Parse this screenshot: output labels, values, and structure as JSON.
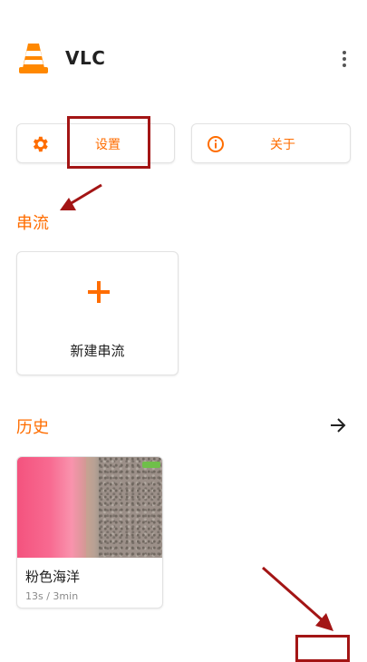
{
  "app": {
    "title": "VLC",
    "logo_icon": "vlc-cone-icon",
    "menu_icon": "more-vertical-icon"
  },
  "actions": {
    "settings": {
      "label": "设置",
      "icon": "gear-icon"
    },
    "about": {
      "label": "关于",
      "icon": "info-icon"
    }
  },
  "stream": {
    "section_title": "串流",
    "new_stream_label": "新建串流",
    "plus_icon": "plus-icon"
  },
  "history": {
    "section_title": "历史",
    "arrow_icon": "arrow-right-icon",
    "items": [
      {
        "title": "粉色海洋",
        "meta": "13s / 3min"
      }
    ]
  },
  "colors": {
    "accent": "#ff6d00",
    "annotation": "#a31515",
    "text": "#212121",
    "muted": "#8a8a8a"
  }
}
